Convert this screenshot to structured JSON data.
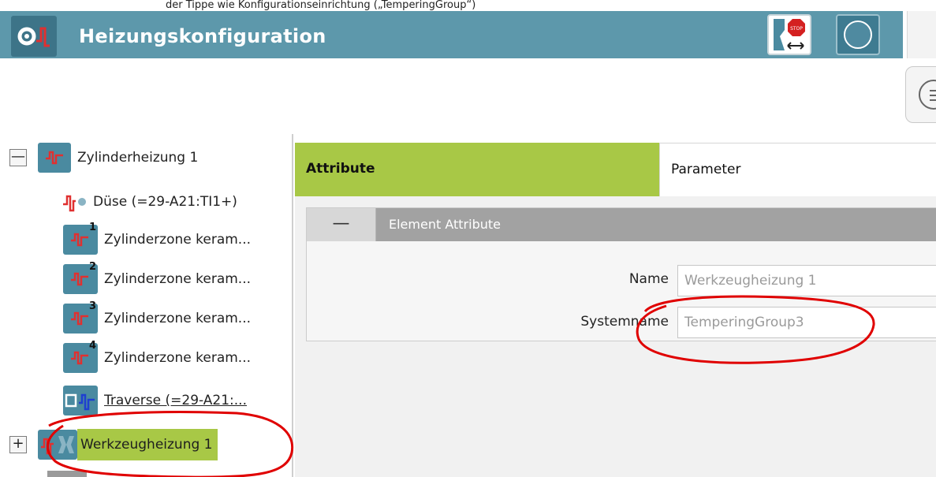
{
  "caption": "der Tippe wie Konfigurationseinrichtung („TemperingGroup“)",
  "app": {
    "title": "Heizungskonfiguration",
    "icon": "settings-heating-icon",
    "toolbar": [
      {
        "name": "stop-button",
        "icon": "stop-sign-icon"
      },
      {
        "name": "circle-button",
        "icon": "circle-icon"
      }
    ],
    "menu_icon": "menu-circle-icon"
  },
  "tree": {
    "nodes": [
      {
        "label": "Zylinderheizung 1",
        "toggle": "—",
        "icon": "heating-zone-icon",
        "level": 0
      },
      {
        "label": "Düse (=29-A21:TI1+)",
        "icon": "nozzle-heating-icon",
        "level": 1
      },
      {
        "label": "Zylinderzone keram...",
        "icon": "cylinder-zone-icon",
        "index": "1",
        "level": 1
      },
      {
        "label": "Zylinderzone keram...",
        "icon": "cylinder-zone-icon",
        "index": "2",
        "level": 1
      },
      {
        "label": "Zylinderzone keram...",
        "icon": "cylinder-zone-icon",
        "index": "3",
        "level": 1
      },
      {
        "label": "Zylinderzone keram...",
        "icon": "cylinder-zone-icon",
        "index": "4",
        "level": 1
      },
      {
        "label": "Traverse (=29-A21:...",
        "icon": "traverse-icon",
        "level": 1
      },
      {
        "label": "Werkzeugheizung 1",
        "toggle": "+",
        "icon": "tool-heating-icon",
        "level": 0,
        "selected": true
      }
    ]
  },
  "tabs": [
    {
      "label": "Attribute",
      "active": true
    },
    {
      "label": "Parameter",
      "active": false
    }
  ],
  "group": {
    "collapse": "—",
    "title": "Element Attribute",
    "fields": [
      {
        "label": "Name",
        "value": "Werkzeugheizung 1"
      },
      {
        "label": "Systemname",
        "value": "TemperingGroup3"
      }
    ]
  },
  "colors": {
    "titlebar": "#5d98ab",
    "accent_green": "#a8c846",
    "annotation_red": "#e00000"
  }
}
